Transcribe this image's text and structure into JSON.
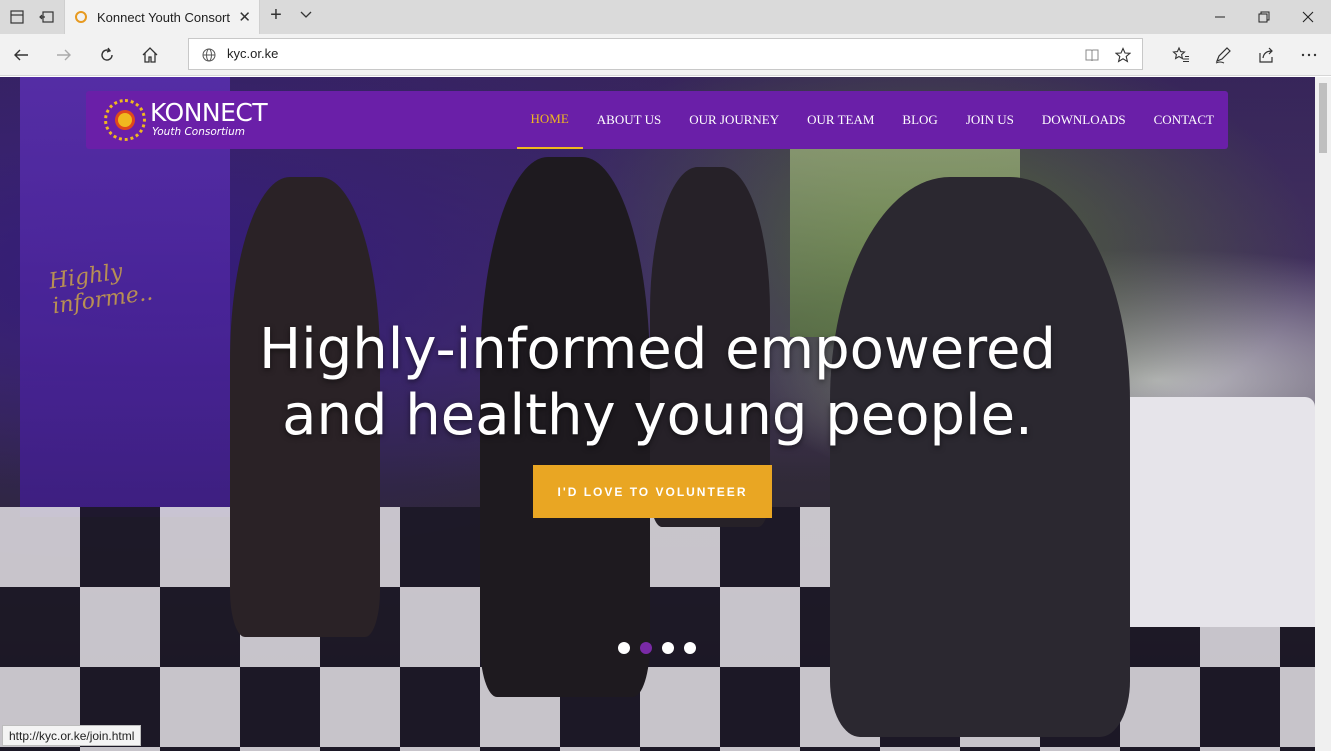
{
  "browser": {
    "tab_title": "Konnect Youth Consorti",
    "url": "kyc.or.ke",
    "status_url": "http://kyc.or.ke/join.html"
  },
  "site": {
    "logo_name": "KONNECT",
    "logo_sub": "Youth Consortium",
    "banner_text": "Highly informe..",
    "menu": [
      "HOME",
      "ABOUT US",
      "OUR JOURNEY",
      "OUR TEAM",
      "BLOG",
      "JOIN US",
      "DOWNLOADS",
      "CONTACT"
    ],
    "active_menu": "HOME",
    "hero_line1": "Highly-informed empowered",
    "hero_line2": "and healthy young people.",
    "cta_label": "I'D LOVE TO VOLUNTEER",
    "carousel_active": 2,
    "carousel_count": 4
  },
  "colors": {
    "header_bg": "#6a1fa8",
    "accent": "#e9a623",
    "active_menu": "#f0b81f"
  }
}
